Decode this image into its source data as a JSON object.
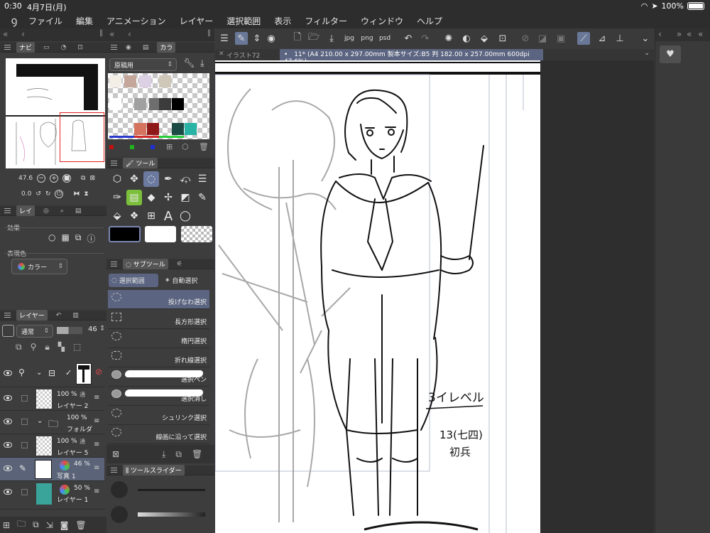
{
  "status": {
    "time": "0:30",
    "date": "4月7日(月)",
    "battery": "100%"
  },
  "menubar": {
    "items": [
      "ファイル",
      "編集",
      "アニメーション",
      "レイヤー",
      "選択範囲",
      "表示",
      "フィルター",
      "ウィンドウ",
      "ヘルプ"
    ]
  },
  "navigator": {
    "tab": "ナビ",
    "zoom": "47.6",
    "angle": "0.0"
  },
  "color_set": {
    "tab": "カラ",
    "set_name": "原稿用"
  },
  "layer_property": {
    "tab": "レイ",
    "effect_label": "効果",
    "expression_label": "表現色",
    "expression_value": "カラー"
  },
  "tool_panel": {
    "tab": "ツール"
  },
  "subtool": {
    "tab": "サブツール",
    "groups": [
      "選択範囲",
      "自動選択"
    ],
    "items": [
      "投げなわ選択",
      "長方形選択",
      "楕円選択",
      "折れ線選択",
      "選択ペン",
      "選択消し",
      "シュリンク選択",
      "線画に沿って選択"
    ]
  },
  "tool_slider": {
    "tab": "ツールスライダー"
  },
  "layers": {
    "tab": "レイヤー",
    "blend_mode": "通常",
    "opacity": "46",
    "rows": [
      {
        "pct": "",
        "mode": "",
        "name": ""
      },
      {
        "pct": "100 %",
        "mode": "通",
        "name": "レイヤー 2"
      },
      {
        "pct": "100 %",
        "mode": "",
        "name": "フォルダ"
      },
      {
        "pct": "100 %",
        "mode": "通",
        "name": "レイヤー 5"
      },
      {
        "pct": "46 %",
        "mode": "",
        "name": "写真 1"
      },
      {
        "pct": "50 %",
        "mode": "",
        "name": "レイヤー 1"
      }
    ]
  },
  "canvas": {
    "closed_tab": "イラスト72",
    "active_tab": "11* (A4 210.00 x 297.00mm 製本サイズ:B5 判 182.00 x 257.00mm 600dpi 47.6%)",
    "note_line1": "3イレベル",
    "note_line2": "13(七四)",
    "note_line3": "初兵"
  },
  "colors": {
    "accent": "#6c7aa0",
    "selection": "#5b6480",
    "nav_frame": "#e02020",
    "swatches": [
      "#f3eee6",
      "#c4a69a",
      "#dcd0e4",
      "#e0e0e0",
      "#cfc7b8",
      "#ffffff",
      "#a0a0a0",
      "#6e6e6e",
      "#3c3c3c",
      "#000000",
      "#d5735e",
      "#8f1818",
      "#1c4a44",
      "#28b3a5"
    ]
  }
}
